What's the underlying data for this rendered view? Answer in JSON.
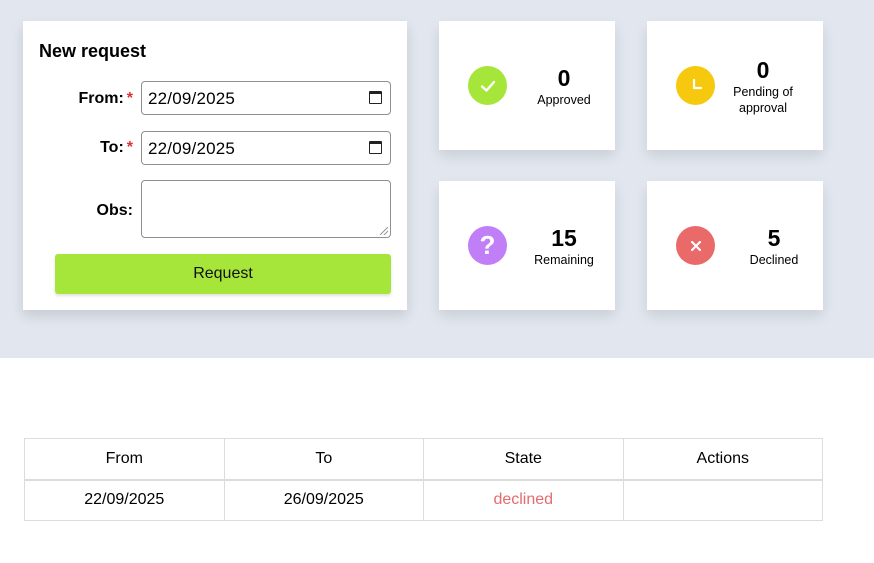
{
  "form": {
    "title": "New request",
    "from_label": "From:",
    "to_label": "To:",
    "obs_label": "Obs:",
    "required_mark": "*",
    "from_value": "22/09/2025",
    "to_value": "22/09/2025",
    "obs_value": "",
    "submit_label": "Request"
  },
  "stats": {
    "approved": {
      "value": "0",
      "label": "Approved",
      "color": "#a6e53a",
      "icon": "check-icon"
    },
    "pending": {
      "value": "0",
      "label": "Pending of approval",
      "color": "#f6c90e",
      "icon": "clock-icon"
    },
    "remaining": {
      "value": "15",
      "label": "Remaining",
      "color": "#c07ef7",
      "icon": "question-icon"
    },
    "declined": {
      "value": "5",
      "label": "Declined",
      "color": "#ea6a6a",
      "icon": "close-icon"
    }
  },
  "table": {
    "headers": [
      "From",
      "To",
      "State",
      "Actions"
    ],
    "rows": [
      {
        "from": "22/09/2025",
        "to": "26/09/2025",
        "state": "declined",
        "actions": ""
      }
    ]
  },
  "colors": {
    "background_band": "#e1e6ef",
    "accent_green": "#a6e53a",
    "declined_text": "#e56b6b",
    "required_star": "#e03131"
  }
}
